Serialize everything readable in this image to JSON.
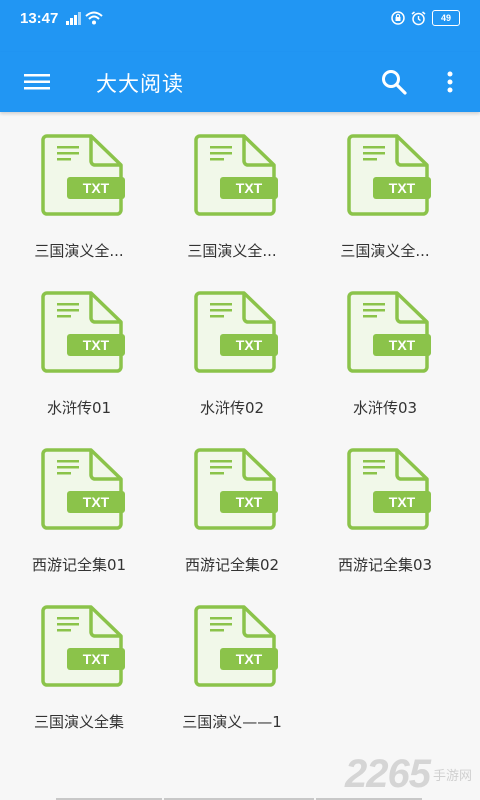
{
  "status_bar": {
    "time": "13:47",
    "battery": "49"
  },
  "app_bar": {
    "title": "大大阅读"
  },
  "file_badge": "TXT",
  "files": [
    {
      "name": "三国演义全..."
    },
    {
      "name": "三国演义全..."
    },
    {
      "name": "三国演义全..."
    },
    {
      "name": "水浒传01"
    },
    {
      "name": "水浒传02"
    },
    {
      "name": "水浒传03"
    },
    {
      "name": "西游记全集01"
    },
    {
      "name": "西游记全集02"
    },
    {
      "name": "西游记全集03"
    },
    {
      "name": "三国演义全集"
    },
    {
      "name": "三国演义——1"
    }
  ],
  "watermark": {
    "number": "2265",
    "site": "手游网"
  },
  "colors": {
    "primary": "#2196f3",
    "icon_green": "#8bc34a",
    "icon_fill": "#f1f8e9",
    "text": "#333333"
  },
  "icons": {
    "menu": "hamburger-menu-icon",
    "search": "search-icon",
    "more": "more-vertical-icon",
    "file": "txt-file-icon"
  }
}
